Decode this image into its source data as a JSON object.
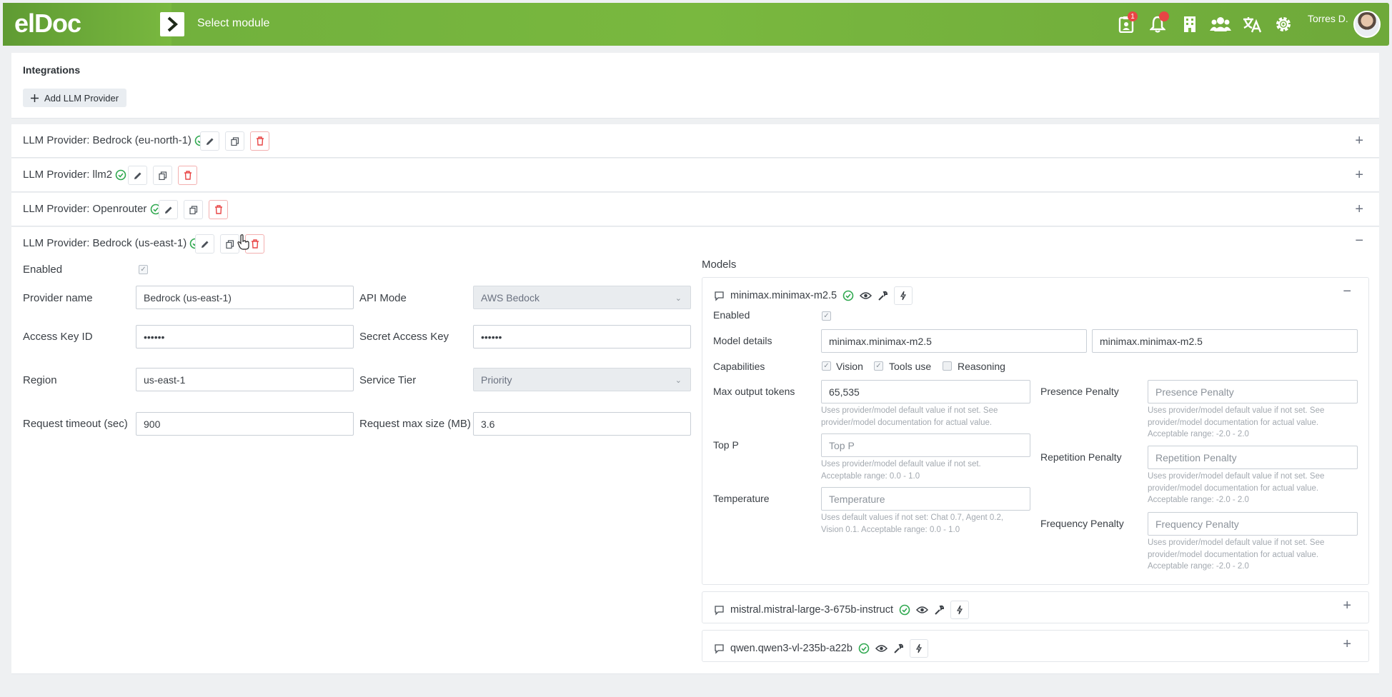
{
  "header": {
    "logo": "elDoc",
    "module_label": "Select module",
    "notification_badge": "1",
    "user_name": "Torres D."
  },
  "integrations": {
    "title": "Integrations",
    "add_button": "Add LLM Provider"
  },
  "providers": [
    {
      "title": "LLM Provider: Bedrock (eu-north-1)"
    },
    {
      "title": "LLM Provider: llm2"
    },
    {
      "title": "LLM Provider: Openrouter"
    },
    {
      "title": "LLM Provider: Bedrock (us-east-1)"
    }
  ],
  "provider_form": {
    "enabled_label": "Enabled",
    "provider_name_label": "Provider name",
    "provider_name_value": "Bedrock (us-east-1)",
    "api_mode_label": "API Mode",
    "api_mode_value": "AWS Bedock",
    "access_key_label": "Access Key ID",
    "access_key_value": "••••••",
    "secret_key_label": "Secret Access Key",
    "secret_key_value": "••••••",
    "region_label": "Region",
    "region_value": "us-east-1",
    "service_tier_label": "Service Tier",
    "service_tier_value": "Priority",
    "timeout_label": "Request timeout (sec)",
    "timeout_value": "900",
    "max_size_label": "Request max size (MB)",
    "max_size_value": "3.6"
  },
  "models": {
    "title": "Models",
    "items": [
      {
        "name": "minimax.minimax-m2.5"
      },
      {
        "name": "mistral.mistral-large-3-675b-instruct"
      },
      {
        "name": "qwen.qwen3-vl-235b-a22b"
      }
    ],
    "detail": {
      "enabled_label": "Enabled",
      "model_details_label": "Model details",
      "model_details_value1": "minimax.minimax-m2.5",
      "model_details_value2": "minimax.minimax-m2.5",
      "capabilities_label": "Capabilities",
      "cap_vision": "Vision",
      "cap_tools": "Tools use",
      "cap_reasoning": "Reasoning",
      "max_tokens_label": "Max output tokens",
      "max_tokens_value": "65,535",
      "max_tokens_hint1": "Uses provider/model default value if not set. See",
      "max_tokens_hint2": "provider/model documentation for actual value.",
      "top_p_label": "Top P",
      "top_p_placeholder": "Top P",
      "top_p_hint1": "Uses provider/model default value if not set.",
      "top_p_hint2": "Acceptable range: 0.0 - 1.0",
      "temperature_label": "Temperature",
      "temperature_placeholder": "Temperature",
      "temperature_hint1": "Uses default values if not set: Chat 0.7, Agent 0.2,",
      "temperature_hint2": "Vision 0.1. Acceptable range: 0.0 - 1.0",
      "presence_label": "Presence Penalty",
      "presence_placeholder": "Presence Penalty",
      "presence_hint1": "Uses provider/model default value if not set. See",
      "presence_hint2": "provider/model documentation for actual value.",
      "presence_hint3": "Acceptable range: -2.0 - 2.0",
      "repetition_label": "Repetition Penalty",
      "repetition_placeholder": "Repetition Penalty",
      "repetition_hint1": "Uses provider/model default value if not set. See",
      "repetition_hint2": "provider/model documentation for actual value.",
      "repetition_hint3": "Acceptable range: -2.0 - 2.0",
      "frequency_label": "Frequency Penalty",
      "frequency_placeholder": "Frequency Penalty",
      "frequency_hint1": "Uses provider/model default value if not set. See",
      "frequency_hint2": "provider/model documentation for actual value.",
      "frequency_hint3": "Acceptable range: -2.0 - 2.0"
    }
  },
  "colors": {
    "brand_green": "#79b83f",
    "ok_green": "#2fa84f",
    "delete_red": "#e84545"
  }
}
